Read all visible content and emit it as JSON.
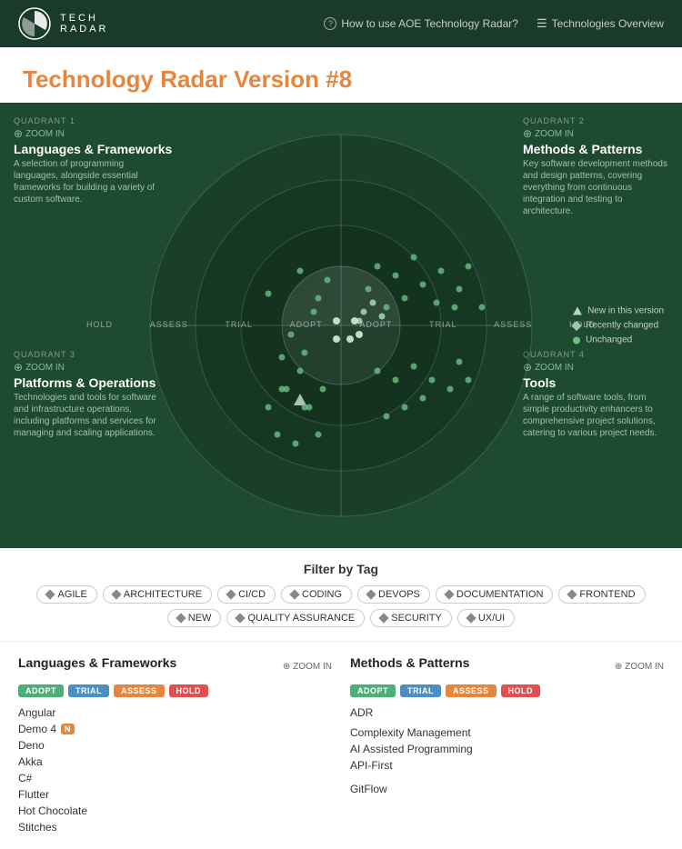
{
  "header": {
    "logo_line1": "TECH",
    "logo_line2": "RADAR",
    "nav_help": "How to use AOE Technology Radar?",
    "nav_overview": "Technologies Overview"
  },
  "title": {
    "prefix": "Technology Radar ",
    "version": "Version #8"
  },
  "quadrants": {
    "q1_tag": "QUADRANT 1",
    "q1_zoom": "ZOOM IN",
    "q1_title": "Languages & Frameworks",
    "q1_desc": "A selection of programming languages, alongside essential frameworks for building a variety of custom software.",
    "q2_tag": "QUADRANT 2",
    "q2_zoom": "ZOOM IN",
    "q2_title": "Methods & Patterns",
    "q2_desc": "Key software development methods and design patterns, covering everything from continuous integration and testing to architecture.",
    "q3_tag": "QUADRANT 3",
    "q3_zoom": "ZOOM IN",
    "q3_title": "Platforms & Operations",
    "q3_desc": "Technologies and tools for software and infrastructure operations, including platforms and services for managing and scaling applications.",
    "q4_tag": "QUADRANT 4",
    "q4_zoom": "ZOOM IN",
    "q4_title": "Tools",
    "q4_desc": "A range of software tools, from simple productivity enhancers to comprehensive project solutions, catering to various project needs."
  },
  "rings": {
    "labels": [
      "HOLD",
      "ASSESS",
      "TRIAL",
      "ADOPT",
      "ADOPT",
      "TRIAL",
      "ASSESS",
      "HOLD"
    ]
  },
  "legend": {
    "new_label": "New in this version",
    "changed_label": "Recently changed",
    "unchanged_label": "Unchanged"
  },
  "filter": {
    "title": "Filter by Tag",
    "tags": [
      "AGILE",
      "ARCHITECTURE",
      "CI/CD",
      "CODING",
      "DEVOPS",
      "DOCUMENTATION",
      "FRONTEND",
      "NEW",
      "QUALITY ASSURANCE",
      "SECURITY",
      "UX/UI"
    ]
  },
  "bottom": {
    "panel1_title": "Languages & Frameworks",
    "panel1_zoom": "ZOOM IN",
    "panel2_title": "Methods & Patterns",
    "panel2_zoom": "ZOOM IN",
    "panel1_items": {
      "adopt": [
        {
          "name": "Angular",
          "new": false
        }
      ],
      "trial": [
        {
          "name": "Demo 4",
          "new": true
        }
      ],
      "assess": [
        {
          "name": "Deno",
          "new": false
        }
      ],
      "hold": [
        {
          "name": "Akka",
          "new": false
        }
      ],
      "adopt_more": [
        {
          "name": "C#",
          "new": false
        }
      ],
      "trial_more": [
        {
          "name": "Flutter",
          "new": false
        }
      ],
      "assess_more": [
        {
          "name": "Hot Chocolate",
          "new": false
        }
      ],
      "hold_more": [
        {
          "name": "Stitches",
          "new": false
        }
      ]
    },
    "panel2_items": {
      "adopt": [
        {
          "name": "ADR",
          "new": false
        }
      ],
      "trial": [
        {
          "name": "",
          "new": false
        }
      ],
      "assess": [
        {
          "name": "Complexity Management",
          "new": false
        }
      ],
      "hold": [
        {
          "name": "AI Assisted Programming",
          "new": false
        }
      ],
      "adopt_more": [
        {
          "name": "API-First",
          "new": false
        }
      ],
      "trial_more": [
        {
          "name": "",
          "new": false
        }
      ],
      "assess_more": [
        {
          "name": "",
          "new": false
        }
      ],
      "hold_more": [
        {
          "name": "GitFlow",
          "new": false
        }
      ]
    }
  }
}
